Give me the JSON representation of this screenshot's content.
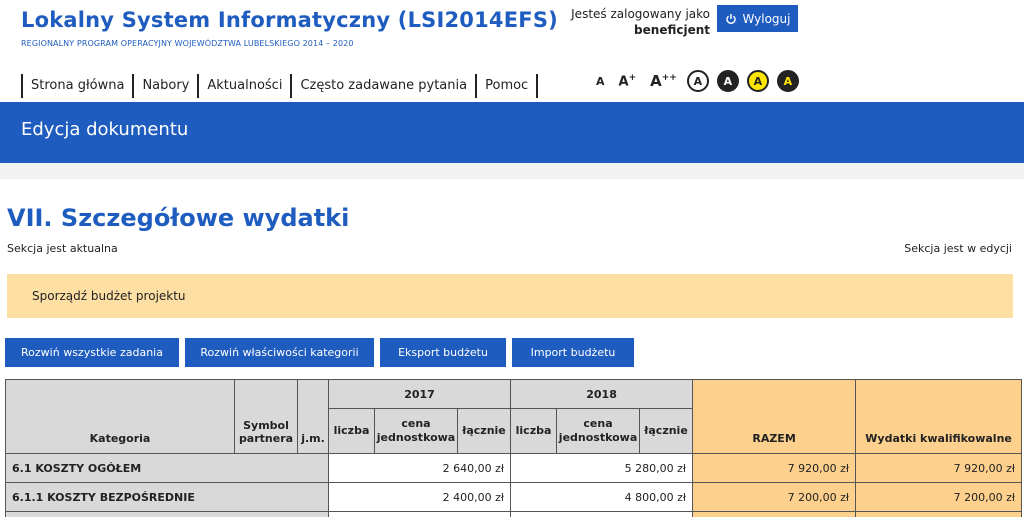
{
  "header": {
    "title": "Lokalny System Informatyczny (LSI2014EFS)",
    "subtitle": "REGIONALNY PROGRAM OPERACYJNY WOJEWÓDZTWA LUBELSKIEGO 2014 – 2020",
    "logged_as": "Jesteś zalogowany jako",
    "user": "beneficjent",
    "logout": "Wyloguj"
  },
  "nav": [
    "Strona główna",
    "Nabory",
    "Aktualności",
    "Często zadawane pytania",
    "Pomoc"
  ],
  "accessibility": {
    "font_small": "A",
    "font_medium": "A",
    "font_medium_sup": "+",
    "font_large": "A",
    "font_large_sup": "++",
    "contrast": [
      "A",
      "A",
      "A",
      "A"
    ]
  },
  "banner": {
    "title": "Edycja dokumentu"
  },
  "section": {
    "title": "VII. Szczegółowe wydatki",
    "status_left": "Sekcja jest aktualna",
    "status_right": "Sekcja jest w edycji"
  },
  "alert": "Sporządź budżet projektu",
  "buttons": [
    "Rozwiń wszystkie zadania",
    "Rozwiń właściwości kategorii",
    "Eksport budżetu",
    "Import budżetu"
  ],
  "table": {
    "headers": {
      "category": "Kategoria",
      "symbol": "Symbol partnera",
      "unit": "j.m.",
      "year1": "2017",
      "year2": "2018",
      "count": "liczba",
      "unit_price": "cena jednostkowa",
      "total": "łącznie",
      "razem": "RAZEM",
      "qualified": "Wydatki kwalifikowalne"
    },
    "rows": [
      {
        "category": "6.1 KOSZTY OGÓŁEM",
        "y2017": "2 640,00 zł",
        "y2018": "5 280,00 zł",
        "razem": "7 920,00 zł",
        "qualified": "7 920,00 zł"
      },
      {
        "category": "6.1.1 KOSZTY BEZPOŚREDNIE",
        "y2017": "2 400,00 zł",
        "y2018": "4 800,00 zł",
        "razem": "7 200,00 zł",
        "qualified": "7 200,00 zł"
      }
    ]
  },
  "colors": {
    "brand_blue": "#1f5cbf",
    "alert_bg": "#fddfa4",
    "summary_orange": "#fdd08e",
    "header_gray": "#d9d9d9"
  }
}
